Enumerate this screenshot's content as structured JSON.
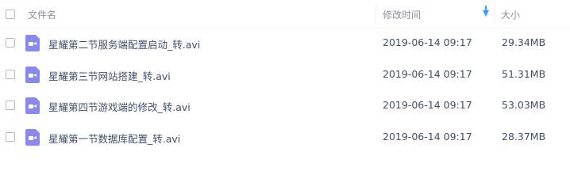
{
  "header": {
    "name_label": "文件名",
    "time_label": "修改时间",
    "size_label": "大小",
    "sort_icon": "sort-down-arrow",
    "sort_color": "#3b9bf5"
  },
  "files": [
    {
      "name": "星耀第二节服务端配置启动_转.avi",
      "modified": "2019-06-14 09:17",
      "size": "29.34MB",
      "icon": "video-file-icon"
    },
    {
      "name": "星耀第三节网站搭建_转.avi",
      "modified": "2019-06-14 09:17",
      "size": "51.31MB",
      "icon": "video-file-icon"
    },
    {
      "name": "星耀第四节游戏端的修改_转.avi",
      "modified": "2019-06-14 09:17",
      "size": "53.03MB",
      "icon": "video-file-icon"
    },
    {
      "name": "星耀第一节数据库配置_转.avi",
      "modified": "2019-06-14 09:17",
      "size": "28.37MB",
      "icon": "video-file-icon"
    }
  ],
  "colors": {
    "icon": "#8a89e8",
    "text": "#424e67",
    "header_text": "#8c9099"
  }
}
